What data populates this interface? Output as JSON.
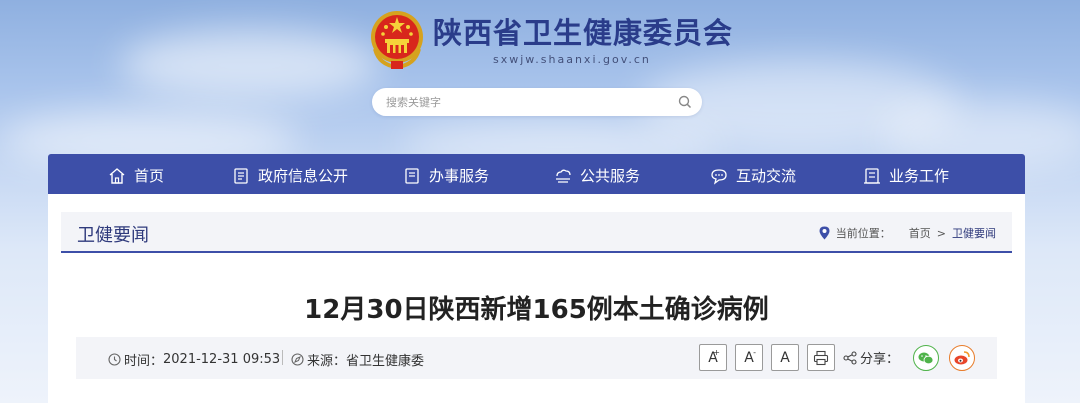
{
  "header": {
    "site_name": "陕西省卫生健康委员会",
    "domain": "sxwjw.shaanxi.gov.cn"
  },
  "search": {
    "placeholder": "搜索关键字"
  },
  "nav": {
    "items": [
      {
        "label": "首页",
        "icon": "home-icon"
      },
      {
        "label": "政府信息公开",
        "icon": "document-list-icon"
      },
      {
        "label": "办事服务",
        "icon": "clipboard-icon"
      },
      {
        "label": "公共服务",
        "icon": "cloud-service-icon"
      },
      {
        "label": "互动交流",
        "icon": "chat-icon"
      },
      {
        "label": "业务工作",
        "icon": "briefcase-icon"
      }
    ]
  },
  "section": {
    "title": "卫健要闻",
    "location_label": "当前位置：",
    "breadcrumb": [
      "首页",
      "卫健要闻"
    ],
    "separator": ">"
  },
  "article": {
    "title": "12月30日陕西新增165例本土确诊病例",
    "time_label": "时间：",
    "time": "2021-12-31 09:53",
    "source_label": "来源：",
    "source": "省卫生健康委",
    "font_large": "A",
    "font_medium": "A",
    "font_small": "A",
    "share_label": "分享："
  },
  "colors": {
    "nav_bg": "#3d4fa8",
    "title_blue": "#2a3c8a",
    "wechat_green": "#4fb34a",
    "weibo_orange": "#e87c2a"
  }
}
